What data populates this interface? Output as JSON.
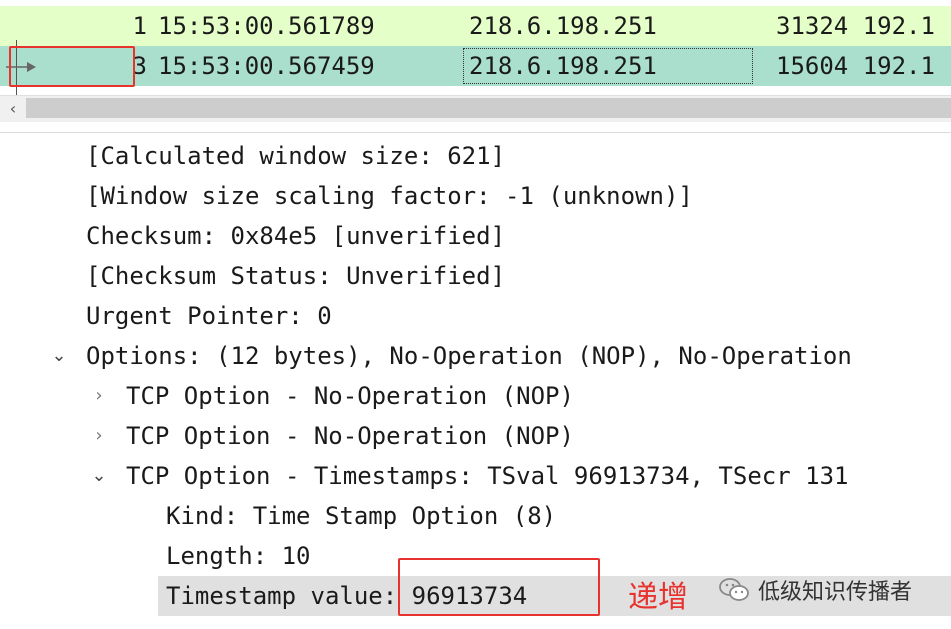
{
  "packets": [
    {
      "no": "1",
      "time": "15:53:00.561789",
      "src": "218.6.198.251",
      "dst": "31324 192.1"
    },
    {
      "no": "3",
      "time": "15:53:00.567459",
      "src": "218.6.198.251",
      "dst": "15604 192.1"
    }
  ],
  "details": {
    "calc_window": "[Calculated window size: 621]",
    "win_scale": "[Window size scaling factor: -1 (unknown)]",
    "checksum": "Checksum: 0x84e5 [unverified]",
    "checksum_status": "[Checksum Status: Unverified]",
    "urgent": "Urgent Pointer: 0",
    "options": "Options: (12 bytes), No-Operation (NOP), No-Operation",
    "opt_nop1": "TCP Option - No-Operation (NOP)",
    "opt_nop2": "TCP Option - No-Operation (NOP)",
    "opt_ts": "TCP Option - Timestamps: TSval 96913734, TSecr 131",
    "kind": "Kind: Time Stamp Option (8)",
    "length": "Length: 10",
    "ts_value": "Timestamp value: 96913734"
  },
  "annotation": "递增",
  "watermark": "低级知识传播者",
  "icons": {
    "related": "related-packet-arrow-icon",
    "scroll_left": "chevron-left-icon",
    "expanded": "chevron-down-icon",
    "collapsed": "chevron-right-icon",
    "watermark": "wechat-icon"
  },
  "colors": {
    "row_normal": "#e4ffc7",
    "row_selected": "#a9dfcc",
    "annotation": "#e8322e"
  }
}
